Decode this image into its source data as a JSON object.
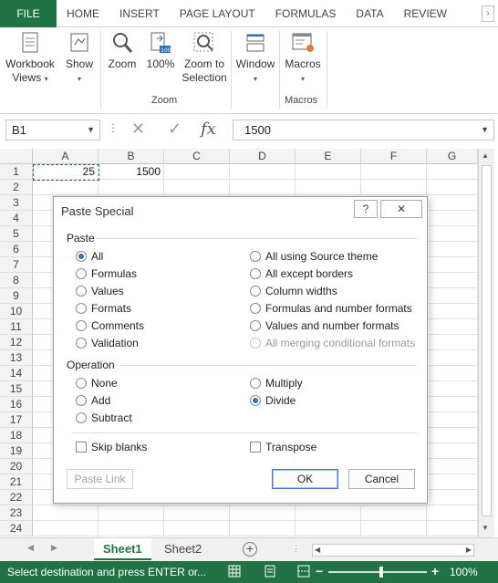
{
  "ribbon_tabs": [
    "FILE",
    "HOME",
    "INSERT",
    "PAGE LAYOUT",
    "FORMULAS",
    "DATA",
    "REVIEW"
  ],
  "ribbon": {
    "workbook_views": "Workbook\nViews",
    "show": "Show",
    "zoom": "Zoom",
    "hundred": "100%",
    "zoom_to_selection": "Zoom to\nSelection",
    "window": "Window",
    "macros": "Macros",
    "group_zoom": "Zoom",
    "group_macros": "Macros"
  },
  "formula_bar": {
    "name_box": "B1",
    "formula": "1500",
    "fx": "fx"
  },
  "columns": [
    "A",
    "B",
    "C",
    "D",
    "E",
    "F",
    "G"
  ],
  "rows": [
    "1",
    "2",
    "3",
    "4",
    "5",
    "6",
    "7",
    "8",
    "9",
    "10",
    "11",
    "12",
    "13",
    "14",
    "15",
    "16",
    "17",
    "18",
    "19",
    "20",
    "21",
    "22",
    "23",
    "24"
  ],
  "cells": {
    "A1": "25",
    "B1": "1500"
  },
  "dialog": {
    "title": "Paste Special",
    "help": "?",
    "close": "✕",
    "paste_section": "Paste",
    "paste_left": [
      "All",
      "Formulas",
      "Values",
      "Formats",
      "Comments",
      "Validation"
    ],
    "paste_right": [
      "All using Source theme",
      "All except borders",
      "Column widths",
      "Formulas and number formats",
      "Values and number formats",
      "All merging conditional formats"
    ],
    "operation_section": "Operation",
    "op_left": [
      "None",
      "Add",
      "Subtract"
    ],
    "op_right": [
      "Multiply",
      "Divide"
    ],
    "skip_blanks": "Skip blanks",
    "transpose": "Transpose",
    "paste_link": "Paste Link",
    "ok": "OK",
    "cancel": "Cancel"
  },
  "sheets": [
    "Sheet1",
    "Sheet2"
  ],
  "status": {
    "message": "Select destination and press ENTER or...",
    "zoom": "100%"
  },
  "colors": {
    "accent": "#217346",
    "radio_dot": "#3d6fb5"
  }
}
